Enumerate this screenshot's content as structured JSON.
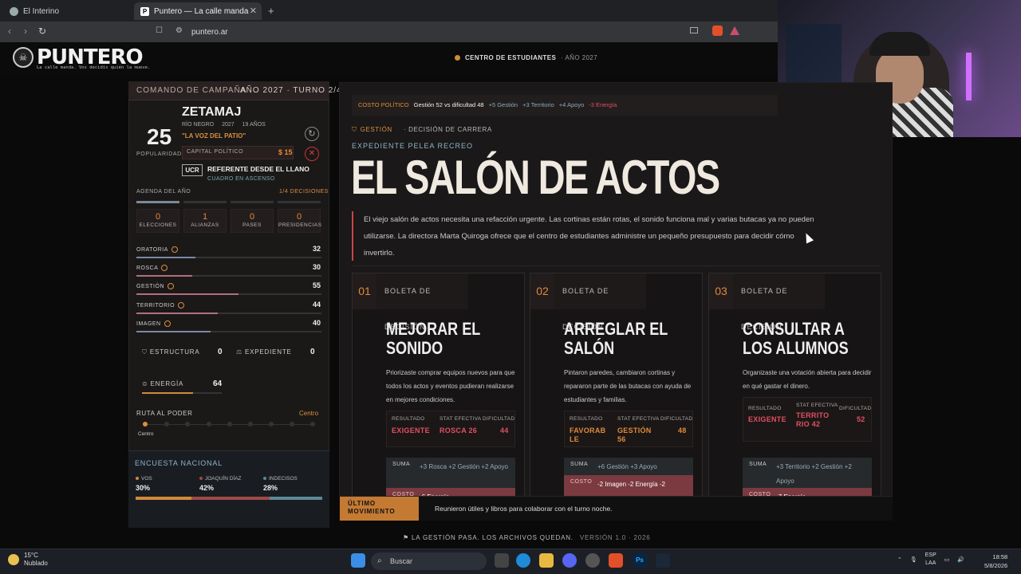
{
  "browser": {
    "tabs": [
      {
        "label": "El Interino"
      },
      {
        "label": "Puntero — La calle manda"
      }
    ],
    "url": "puntero.ar"
  },
  "site": {
    "logo": "PUNTERO",
    "tagline": "La calle manda. Vos decidís quién la mueve.",
    "center": "CENTRO DE ESTUDIANTES",
    "year": "· AÑO 2027"
  },
  "sidebar": {
    "header_title": "COMANDO DE CAMPAÑA",
    "header_turn": "AÑO 2027 · TURNO 2/4",
    "popularity": "25",
    "popularity_label": "POPULARIDAD",
    "name": "ZETAMAJ",
    "meta": [
      "RÍO NEGRO",
      "2027",
      "19 AÑOS"
    ],
    "quote": "\"LA VOZ DEL PATIO\"",
    "capital_label": "CAPITAL POLÍTICO",
    "capital_value": "$ 15",
    "party": "UCR",
    "role": "REFERENTE DESDE EL LLANO",
    "rank": "CUADRO EN ASCENSO",
    "agenda_label": "AGENDA DEL AÑO",
    "agenda_count": "1/4 DECISIONES",
    "agenda_progress": 0.25,
    "stats": [
      {
        "value": "0",
        "label": "ELECCIONES"
      },
      {
        "value": "1",
        "label": "ALIANZAS"
      },
      {
        "value": "0",
        "label": "PASES"
      },
      {
        "value": "0",
        "label": "PRESIDENCIAS"
      }
    ],
    "attributes": [
      {
        "name": "ORATORIA",
        "value": "32",
        "pct": 0.32
      },
      {
        "name": "ROSCA",
        "value": "30",
        "pct": 0.3
      },
      {
        "name": "GESTIÓN",
        "value": "55",
        "pct": 0.55
      },
      {
        "name": "TERRITORIO",
        "value": "44",
        "pct": 0.44
      },
      {
        "name": "IMAGEN",
        "value": "40",
        "pct": 0.4
      }
    ],
    "estructura_label": "ESTRUCTURA",
    "estructura_value": "0",
    "expediente_label": "EXPEDIENTE",
    "expediente_value": "0",
    "energia_label": "ENERGÍA",
    "energia_value": "64",
    "energia_pct": 0.64,
    "ruta_label": "RUTA AL PODER",
    "ruta_value": "Centro",
    "ruta_selected": "Centro",
    "encuesta_title": "ENCUESTA NACIONAL",
    "encuesta": [
      {
        "name": "VOS",
        "value": "30%",
        "share": 30,
        "color": "#d08a3a"
      },
      {
        "name": "JOAQUÍN DÍAZ",
        "value": "42%",
        "share": 42,
        "color": "#a04848"
      },
      {
        "name": "INDECISOS",
        "value": "28%",
        "share": 28,
        "color": "#5f8796"
      }
    ]
  },
  "main": {
    "cost_label": "COSTO POLÍTICO",
    "cost_detail": "Gestión 52 vs dificultad 48",
    "cost_effects": [
      "+5 Gestión",
      "+3 Territorio",
      "+4 Apoyo",
      "-3 Energía"
    ],
    "category": "GESTIÓN",
    "decision": "· DECISIÓN DE CARRERA",
    "expediente": "EXPEDIENTE PELEA RECREO",
    "title": "EL SALÓN DE ACTOS",
    "description": "El viejo salón de actos necesita una refacción urgente. Las cortinas están rotas, el sonido funciona mal y varias butacas ya no pueden utilizarse. La directora Marta Quiroga ofrece que el centro de estudiantes administre un pequeño presupuesto para decidir cómo invertirlo.",
    "cards": [
      {
        "num": "01",
        "tab": "BOLETA DE DECISIÓN",
        "title": "MEJORAR EL SONIDO",
        "desc": "Priorizaste comprar equipos nuevos para que todos los actos y eventos pudieran realizarse en mejores condiciones.",
        "res_label": "RESULTADO",
        "res_value": "EXIGENTE",
        "stat_label": "STAT EFECTIVA",
        "stat_value": "ROSCA 26",
        "dif_label": "DIFICULTAD",
        "dif_value": "44",
        "sum_label": "SUMA",
        "sum": "+3 Rosca   +2 Gestión   +2 Apoyo",
        "cost_label": "COSTO",
        "cost": "-6 Energía"
      },
      {
        "num": "02",
        "tab": "BOLETA DE DECISIÓN",
        "title": "ARREGLAR EL SALÓN",
        "desc": "Pintaron paredes, cambiaron cortinas y repararon parte de las butacas con ayuda de estudiantes y familias.",
        "res_label": "RESULTADO",
        "res_value": "FAVORABLE",
        "stat_label": "STAT EFECTIVA",
        "stat_value": "GESTIÓN 56",
        "dif_label": "DIFICULTAD",
        "dif_value": "48",
        "sum_label": "SUMA",
        "sum": "+6 Gestión   +3 Apoyo",
        "cost_label": "COSTO",
        "cost": "-2 Imagen   -2 Energía   -2 Estructura"
      },
      {
        "num": "03",
        "tab": "BOLETA DE DECISIÓN",
        "title": "CONSULTAR A LOS ALUMNOS",
        "desc": "Organizaste una votación abierta para decidir en qué gastar el dinero.",
        "res_label": "RESULTADO",
        "res_value": "EXIGENTE",
        "stat_label": "STAT EFECTIVA",
        "stat_value": "TERRITORIO 42",
        "dif_label": "DIFICULTAD",
        "dif_value": "52",
        "sum_label": "SUMA",
        "sum": "+3 Territorio   +2 Gestión   +2 Apoyo",
        "cost_label": "COSTO",
        "cost": "-7 Energía"
      }
    ],
    "last_move_label": "ÚLTIMO MOVIMIENTO",
    "last_move_text": "Reunieron útiles y libros para colaborar con el turno noche.",
    "footer": "LA GESTIÓN PASA. LOS ARCHIVOS QUEDAN.",
    "version": "VERSIÓN 1.0 · 2026"
  },
  "taskbar": {
    "temp": "15°C",
    "weather": "Nublado",
    "search": "Buscar",
    "lang": "ESP",
    "lang2": "LAA",
    "time": "18:58",
    "date": "5/8/2026"
  }
}
